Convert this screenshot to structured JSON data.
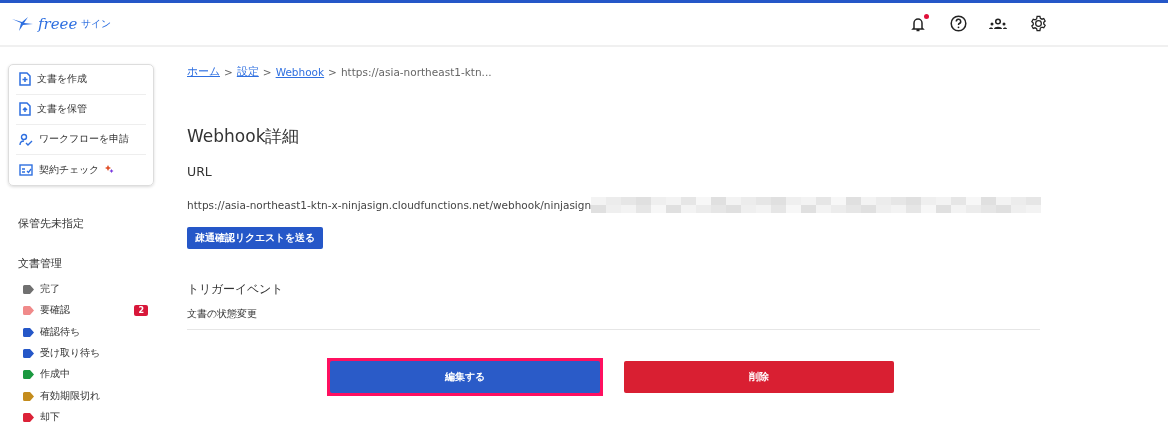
{
  "header": {
    "logo": "freee",
    "logo_suffix": "サイン",
    "notifications_unread": true
  },
  "sidebar": {
    "actions": [
      {
        "label": "文書を作成",
        "sparkle": false
      },
      {
        "label": "文書を保管",
        "sparkle": false
      },
      {
        "label": "ワークフローを申請",
        "sparkle": false
      },
      {
        "label": "契約チェック",
        "sparkle": true
      }
    ],
    "unassigned": "保管先未指定",
    "section": "文書管理",
    "statuses": [
      {
        "label": "完了",
        "color": "#707070"
      },
      {
        "label": "要確認",
        "color": "#f08a8a",
        "count": "2"
      },
      {
        "label": "確認待ち",
        "color": "#2557c8"
      },
      {
        "label": "受け取り待ち",
        "color": "#2557c8"
      },
      {
        "label": "作成中",
        "color": "#1a9940"
      },
      {
        "label": "有効期限切れ",
        "color": "#c48c1c"
      },
      {
        "label": "却下",
        "color": "#dc2238"
      }
    ]
  },
  "breadcrumb": [
    {
      "label": "ホーム",
      "link": true
    },
    {
      "label": "設定",
      "link": true
    },
    {
      "label": "Webhook",
      "link": true
    },
    {
      "label": "https://asia-northeast1-ktn...",
      "link": false
    }
  ],
  "breadcrumb_separators": [
    ">",
    ">",
    ">"
  ],
  "title": "Webhook詳細",
  "url_label": "URL",
  "url": "https://asia-northeast1-ktn-x-ninjasign.cloudfunctions.net/webhook/ninjasign",
  "url_redacted": true,
  "test_button": "疎通確認リクエストを送る",
  "trigger_label": "トリガーイベント",
  "trigger_value": "文書の状態変更",
  "buttons": [
    {
      "label": "編集する",
      "kind": "primary",
      "highlighted": true
    },
    {
      "label": "削除",
      "kind": "danger",
      "highlighted": false
    }
  ]
}
